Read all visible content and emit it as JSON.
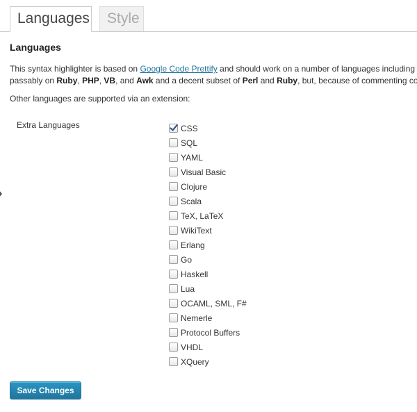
{
  "tabs": [
    {
      "label": "Languages",
      "active": true
    },
    {
      "label": "Style",
      "active": false
    }
  ],
  "section": {
    "title": "Languages"
  },
  "intro": {
    "line1_part1": "This syntax highlighter is based on ",
    "link_text": "Google Code Prettify",
    "line1_part2": " and should work on a number of languages including",
    "line2_part1": "passably on ",
    "lang_ruby": "Ruby",
    "sep1": ", ",
    "lang_php": "PHP",
    "sep2": ", ",
    "lang_vb": "VB",
    "sep3": ", and ",
    "lang_awk": "Awk",
    "line2_part2": " and a decent subset of ",
    "lang_perl": "Perl",
    "sep4": " and ",
    "lang_ruby2": "Ruby",
    "line2_part3": ", but, because of commenting co"
  },
  "extension_note": "Other languages are supported via an extension:",
  "extra_languages": {
    "label": "Extra Languages",
    "items": [
      {
        "label": "CSS",
        "checked": true
      },
      {
        "label": "SQL",
        "checked": false
      },
      {
        "label": "YAML",
        "checked": false
      },
      {
        "label": "Visual Basic",
        "checked": false
      },
      {
        "label": "Clojure",
        "checked": false
      },
      {
        "label": "Scala",
        "checked": false
      },
      {
        "label": "TeX, LaTeX",
        "checked": false
      },
      {
        "label": "WikiText",
        "checked": false
      },
      {
        "label": "Erlang",
        "checked": false
      },
      {
        "label": "Go",
        "checked": false
      },
      {
        "label": "Haskell",
        "checked": false
      },
      {
        "label": "Lua",
        "checked": false
      },
      {
        "label": "OCAML, SML, F#",
        "checked": false
      },
      {
        "label": "Nemerle",
        "checked": false
      },
      {
        "label": "Protocol Buffers",
        "checked": false
      },
      {
        "label": "VHDL",
        "checked": false
      },
      {
        "label": "XQuery",
        "checked": false
      }
    ]
  },
  "save_button": {
    "label": "Save Changes"
  },
  "colors": {
    "link": "#21759b",
    "button": "#21759b",
    "check": "#2a4f86"
  }
}
